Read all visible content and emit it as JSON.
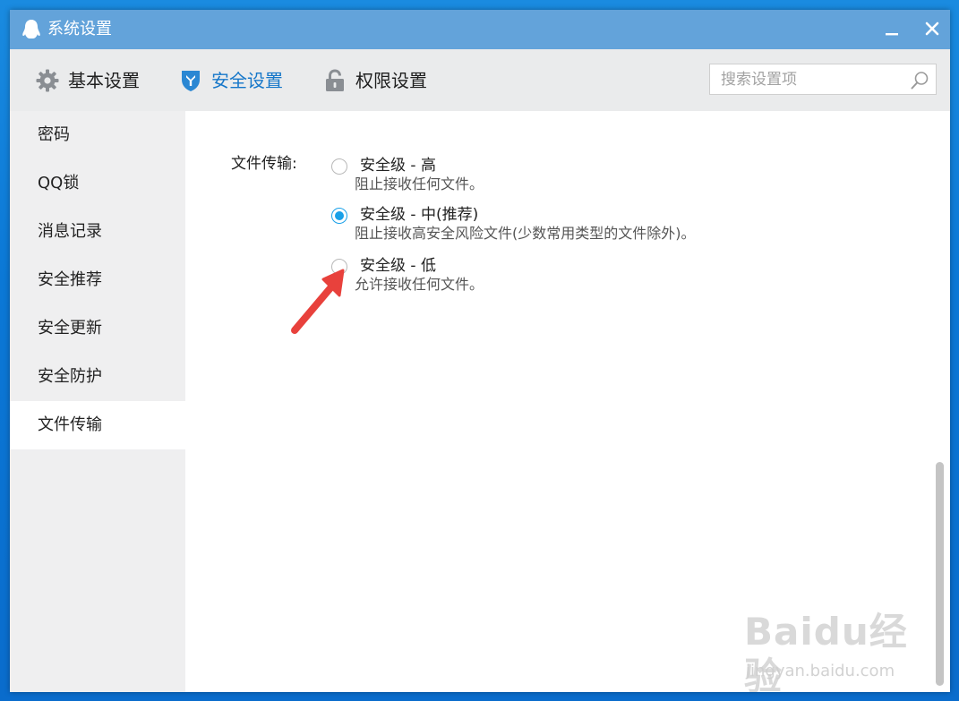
{
  "window": {
    "title": "系统设置",
    "title_icon": "qq-penguin-icon",
    "controls": {
      "minimize_icon": "minimize-icon",
      "close_icon": "close-icon"
    }
  },
  "toolbar": {
    "tabs": [
      {
        "label": "基本设置",
        "icon": "gear-icon",
        "active": false
      },
      {
        "label": "安全设置",
        "icon": "shield-icon",
        "active": true
      },
      {
        "label": "权限设置",
        "icon": "lock-icon",
        "active": false
      }
    ],
    "search": {
      "placeholder": "搜索设置项",
      "value": "",
      "icon": "search-icon"
    }
  },
  "sidebar": {
    "items": [
      {
        "label": "密码",
        "active": false
      },
      {
        "label": "QQ锁",
        "active": false
      },
      {
        "label": "消息记录",
        "active": false
      },
      {
        "label": "安全推荐",
        "active": false
      },
      {
        "label": "安全更新",
        "active": false
      },
      {
        "label": "安全防护",
        "active": false
      },
      {
        "label": "文件传输",
        "active": true
      }
    ]
  },
  "content": {
    "section_label": "文件传输:",
    "options": [
      {
        "title": "安全级 - 高",
        "desc": "阻止接收任何文件。",
        "checked": false
      },
      {
        "title": "安全级 - 中(推荐)",
        "desc": "阻止接收高安全风险文件(少数常用类型的文件除外)。",
        "checked": true
      },
      {
        "title": "安全级 - 低",
        "desc": "允许接收任何文件。",
        "checked": false
      }
    ],
    "annotation": "red-arrow-icon"
  },
  "watermark": {
    "main": "Baidu经验",
    "sub": "jingyan.baidu.com"
  },
  "colors": {
    "titlebar": "#63a3da",
    "accent": "#1677c9",
    "radio_checked": "#19a0e8",
    "arrow": "#e8413c",
    "sidebar_bg": "#efeff0"
  }
}
